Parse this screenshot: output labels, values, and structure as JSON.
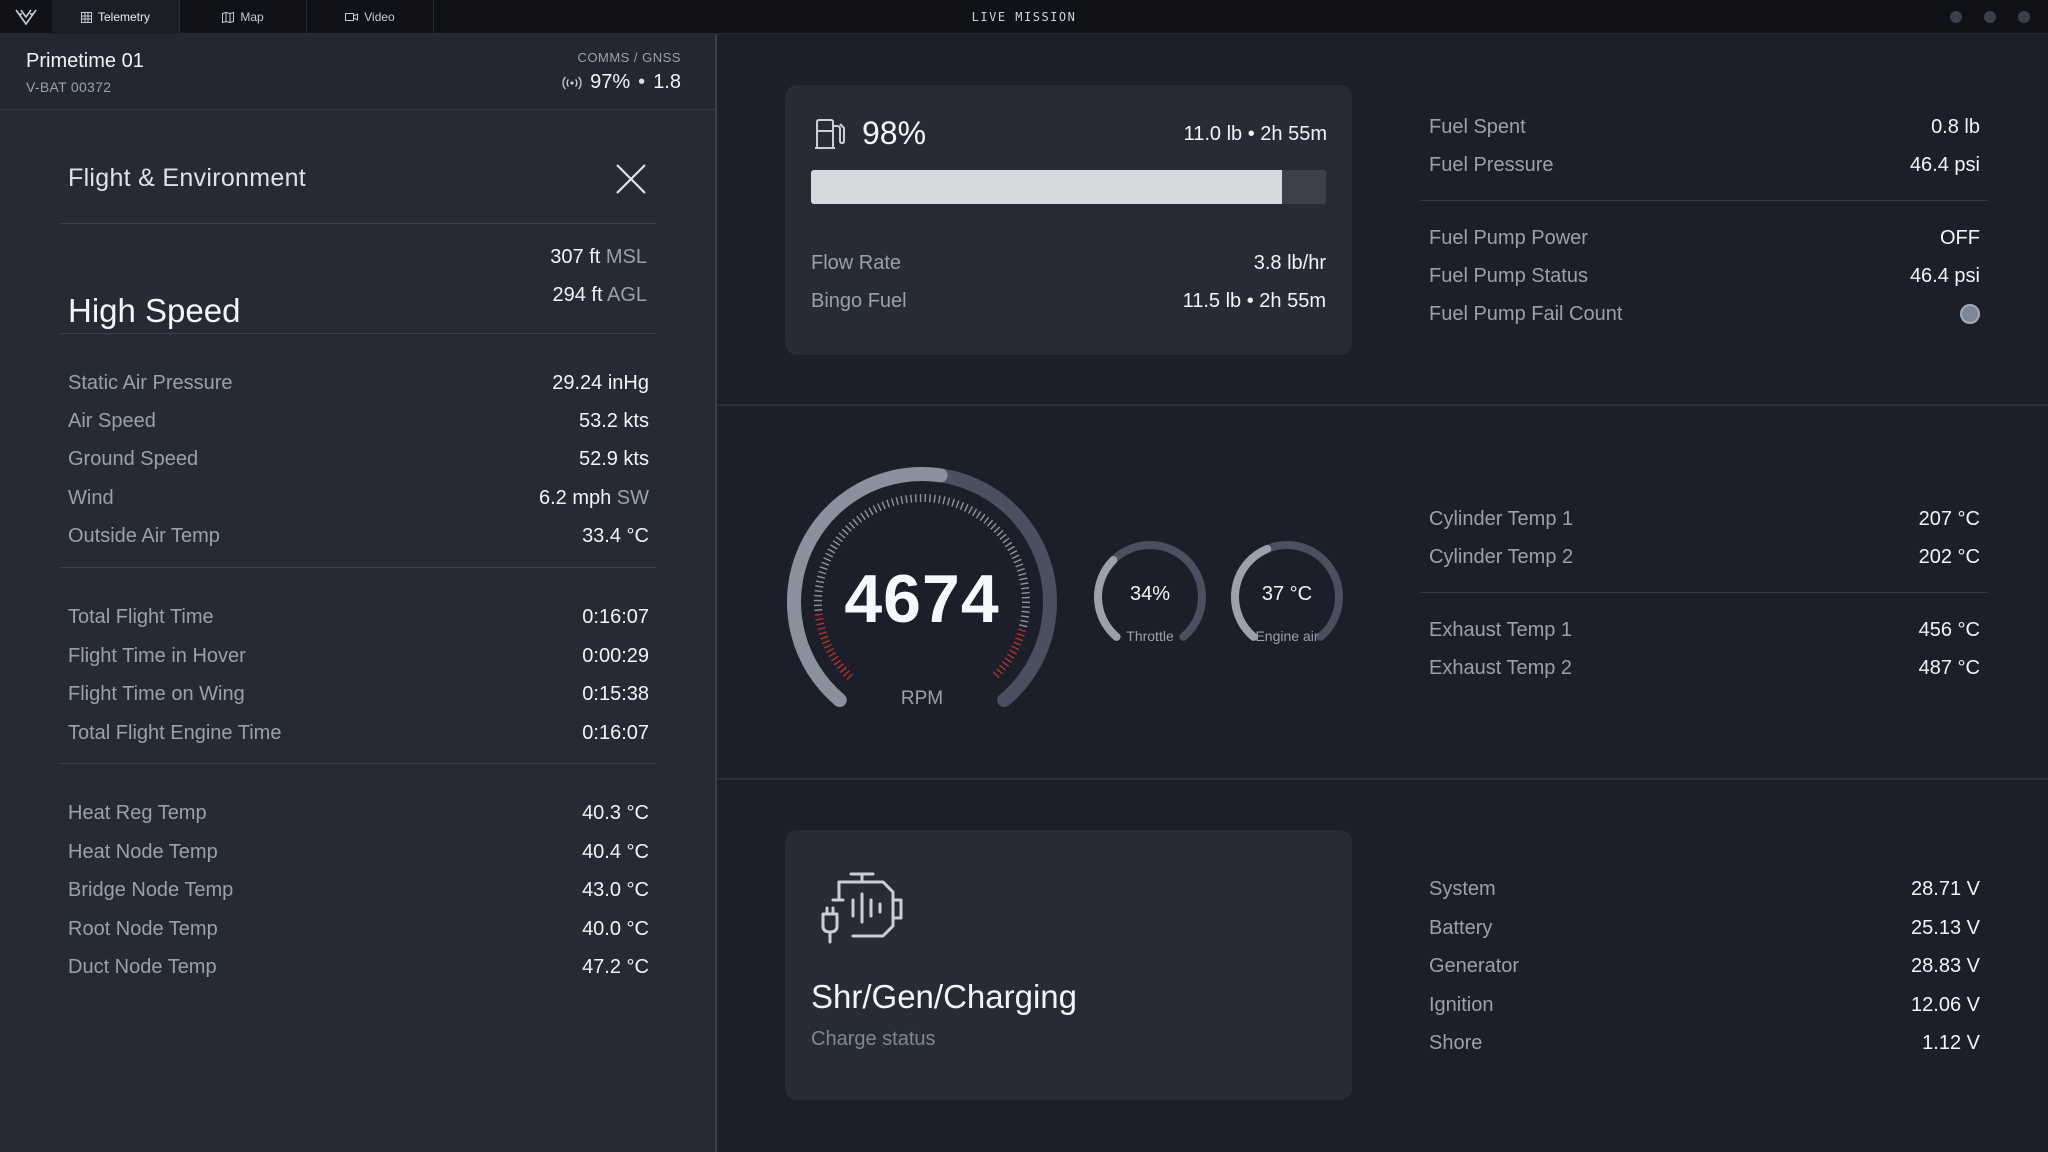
{
  "topbar": {
    "tabs": [
      {
        "label": "Telemetry",
        "icon": "grid-icon",
        "active": true
      },
      {
        "label": "Map",
        "icon": "map-icon",
        "active": false
      },
      {
        "label": "Video",
        "icon": "video-icon",
        "active": false
      }
    ],
    "title": "LIVE MISSION"
  },
  "vehicle": {
    "name": "Primetime 01",
    "id": "V-BAT 00372",
    "comms_label": "COMMS / GNSS",
    "comms_value": "97%",
    "gnss_value": "1.8"
  },
  "panel": {
    "title": "Flight & Environment",
    "mode": "High Speed",
    "altitude_msl": "307 ft",
    "altitude_msl_unit": "MSL",
    "altitude_agl": "294 ft",
    "altitude_agl_unit": "AGL",
    "env_rows": [
      {
        "label": "Static Air Pressure",
        "value": "29.24 inHg"
      },
      {
        "label": "Air Speed",
        "value": "53.2 kts"
      },
      {
        "label": "Ground Speed",
        "value": "52.9 kts"
      },
      {
        "label": "Wind",
        "value": "6.2 mph",
        "suffix": "SW"
      },
      {
        "label": "Outside Air Temp",
        "value": "33.4 °C"
      }
    ],
    "time_rows": [
      {
        "label": "Total Flight Time",
        "value": "0:16:07"
      },
      {
        "label": "Flight Time in Hover",
        "value": "0:00:29"
      },
      {
        "label": "Flight Time on Wing",
        "value": "0:15:38"
      },
      {
        "label": "Total Flight Engine Time",
        "value": "0:16:07"
      }
    ],
    "temp_rows": [
      {
        "label": "Heat Reg Temp",
        "value": "40.3 °C"
      },
      {
        "label": "Heat Node Temp",
        "value": "40.4 °C"
      },
      {
        "label": "Bridge Node Temp",
        "value": "43.0 °C"
      },
      {
        "label": "Root Node Temp",
        "value": "40.0 °C"
      },
      {
        "label": "Duct Node Temp",
        "value": "47.2 °C"
      }
    ]
  },
  "fuel": {
    "percent": "98%",
    "fill_fraction": 0.915,
    "remaining": "11.0 lb • 2h 55m",
    "flow_rate_label": "Flow Rate",
    "flow_rate": "3.8 lb/hr",
    "bingo_label": "Bingo Fuel",
    "bingo": "11.5 lb • 2h 55m",
    "details": [
      {
        "label": "Fuel Spent",
        "value": "0.8 lb"
      },
      {
        "label": "Fuel Pressure",
        "value": "46.4 psi"
      }
    ],
    "pump": [
      {
        "label": "Fuel Pump Power",
        "value": "OFF"
      },
      {
        "label": "Fuel Pump Status",
        "value": "46.4 psi"
      },
      {
        "label": "Fuel Pump Fail Count",
        "value": ""
      }
    ]
  },
  "engine": {
    "rpm": "4674",
    "rpm_label": "RPM",
    "rpm_fraction": 0.53,
    "throttle": "34%",
    "throttle_label": "Throttle",
    "throttle_fraction": 0.34,
    "engine_air": "37 °C",
    "engine_air_label": "Engine air",
    "engine_air_fraction": 0.42,
    "cylinder": [
      {
        "label": "Cylinder Temp 1",
        "value": "207 °C"
      },
      {
        "label": "Cylinder Temp 2",
        "value": "202 °C"
      }
    ],
    "exhaust": [
      {
        "label": "Exhaust Temp 1",
        "value": "456 °C"
      },
      {
        "label": "Exhaust Temp 2",
        "value": "487 °C"
      }
    ]
  },
  "power": {
    "title": "Shr/Gen/Charging",
    "subtitle": "Charge status",
    "voltages": [
      {
        "label": "System",
        "value": "28.71 V"
      },
      {
        "label": "Battery",
        "value": "25.13 V"
      },
      {
        "label": "Generator",
        "value": "28.83 V"
      },
      {
        "label": "Ignition",
        "value": "12.06 V"
      },
      {
        "label": "Shore",
        "value": "1.12 V"
      }
    ]
  },
  "colors": {
    "background": "#1c1f29",
    "panel": "#262a35",
    "card": "#272b36",
    "text": "#f2f4f8",
    "muted": "#9aa0ad",
    "redline": "#b0322c"
  }
}
